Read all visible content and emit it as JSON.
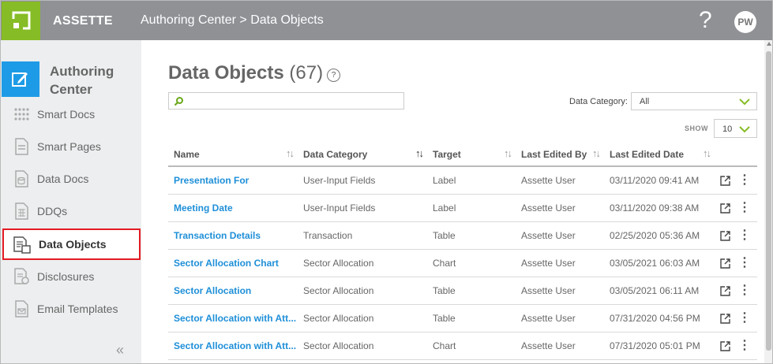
{
  "app": {
    "brand": "ASSETTE",
    "help_glyph": "?",
    "user_initials": "PW",
    "accent": "#86bc25",
    "brand_blue": "#1e9be6",
    "highlight": "#e31b23"
  },
  "breadcrumb": {
    "section": "Authoring Center",
    "separator": ">",
    "page": "Data Objects"
  },
  "sidebar": {
    "title": "Authoring Center",
    "items": [
      {
        "label": "Smart Docs",
        "icon": "grid-dots-icon",
        "active": false
      },
      {
        "label": "Smart Pages",
        "icon": "page-icon",
        "active": false
      },
      {
        "label": "Data Docs",
        "icon": "data-doc-icon",
        "active": false
      },
      {
        "label": "DDQs",
        "icon": "ddq-icon",
        "active": false
      },
      {
        "label": "Data Objects",
        "icon": "data-objects-icon",
        "active": true
      },
      {
        "label": "Disclosures",
        "icon": "disclosure-icon",
        "active": false
      },
      {
        "label": "Email Templates",
        "icon": "email-template-icon",
        "active": false
      }
    ],
    "collapse_glyph": "«"
  },
  "main": {
    "title": "Data Objects",
    "count": "(67)",
    "help_glyph": "?",
    "search": {
      "placeholder": "",
      "value": ""
    },
    "category_filter": {
      "label": "Data Category:",
      "value": "All"
    },
    "show": {
      "label": "SHOW",
      "value": "10"
    },
    "table": {
      "columns": [
        "Name",
        "Data Category",
        "Target",
        "Last Edited By",
        "Last Edited Date"
      ],
      "rows": [
        {
          "name": "Presentation For",
          "category": "User-Input Fields",
          "target": "Label",
          "editor": "Assette User",
          "date": "03/11/2020 09:41 AM"
        },
        {
          "name": "Meeting Date",
          "category": "User-Input Fields",
          "target": "Label",
          "editor": "Assette User",
          "date": "03/11/2020 09:38 AM"
        },
        {
          "name": "Transaction Details",
          "category": "Transaction",
          "target": "Table",
          "editor": "Assette User",
          "date": "02/25/2020 05:36 AM"
        },
        {
          "name": "Sector Allocation Chart",
          "category": "Sector Allocation",
          "target": "Chart",
          "editor": "Assette User",
          "date": "03/05/2021 06:03 AM"
        },
        {
          "name": "Sector Allocation",
          "category": "Sector Allocation",
          "target": "Table",
          "editor": "Assette User",
          "date": "03/05/2021 06:11 AM"
        },
        {
          "name": "Sector Allocation with Att...",
          "category": "Sector Allocation",
          "target": "Table",
          "editor": "Assette User",
          "date": "07/31/2020 04:56 PM"
        },
        {
          "name": "Sector Allocation with Att...",
          "category": "Sector Allocation",
          "target": "Chart",
          "editor": "Assette User",
          "date": "07/31/2020 05:01 PM"
        }
      ]
    }
  }
}
